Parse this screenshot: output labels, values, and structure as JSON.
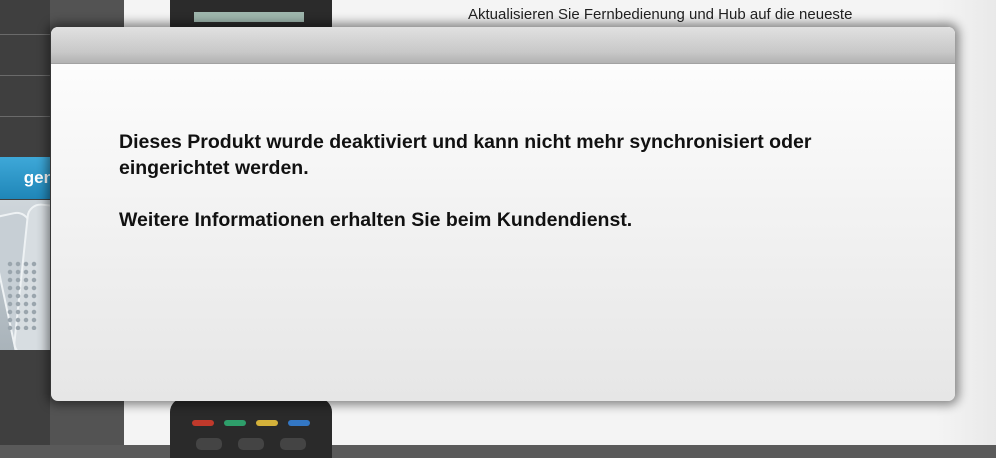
{
  "background": {
    "sidebar_tab_label": "gen",
    "update_text": "Aktualisieren Sie Fernbedienung und Hub auf die neueste"
  },
  "dialog": {
    "message_1": "Dieses Produkt wurde deaktiviert und kann nicht mehr synchronisiert oder eingerichtet werden.",
    "message_2": "Weitere Informationen erhalten Sie beim Kundendienst."
  },
  "colors": {
    "sidebar_tab": "#2a97c9",
    "dialog_header": "#c8c8c8",
    "overlay": "#5a5a5a"
  }
}
